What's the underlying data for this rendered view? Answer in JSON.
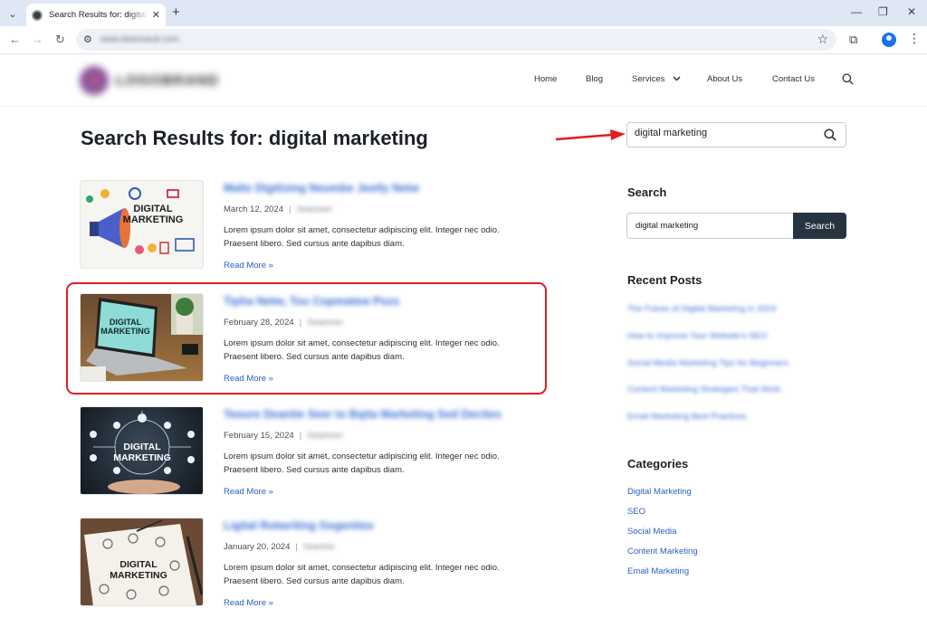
{
  "browser": {
    "tab_title": "Search Results for: digital marketing",
    "url": "www.downsaub.com"
  },
  "site": {
    "logo_text": "LOGOBRAND",
    "nav": [
      "Home",
      "Blog",
      "Services",
      "About Us",
      "Contact Us"
    ]
  },
  "page": {
    "title": "Search Results for: digital marketing",
    "search_value": "digital marketing"
  },
  "results": [
    {
      "title": "Maltz Digitizing Neumbe Jeetly Netw",
      "date": "March 12, 2024",
      "author": "Searlown",
      "excerpt": "Lorem ipsum dolor sit amet, consectetur adipiscing elit. Integer nec odio. Praesent libero. Sed cursus ante dapibus diam.",
      "read_more": "Read More »",
      "thumb_caption": "DIGITAL MARKETING"
    },
    {
      "title": "Tipha Netw, Tou Copmatew Pozs",
      "date": "February 28, 2024",
      "author": "Searlown",
      "excerpt": "Lorem ipsum dolor sit amet, consectetur adipiscing elit. Integer nec odio. Praesent libero. Sed cursus ante dapibus diam.",
      "read_more": "Read More »",
      "thumb_caption": "DIGITAL MARKETING"
    },
    {
      "title": "Teoure Deantie Seer to Bqita Marketing Sed Decites",
      "date": "February 15, 2024",
      "author": "Searlown",
      "excerpt": "Lorem ipsum dolor sit amet, consectetur adipiscing elit. Integer nec odio. Praesent libero. Sed cursus ante dapibus diam.",
      "read_more": "Read More »",
      "thumb_caption": "DIGITAL MARKETING"
    },
    {
      "title": "Ligital Rotwriting Gegenties",
      "date": "January 20, 2024",
      "author": "Searlow",
      "excerpt": "Lorem ipsum dolor sit amet, consectetur adipiscing elit. Integer nec odio. Praesent libero. Sed cursus ante dapibus diam.",
      "read_more": "Read More »",
      "thumb_caption": "DIGITAL MARKETING"
    }
  ],
  "sidebar": {
    "search_heading": "Search",
    "search_value": "digital marketing",
    "search_button": "Search",
    "recent_heading": "Recent Posts",
    "recent_posts": [
      "The Future of Digital Marketing in 2024",
      "How to Improve Your Website's SEO",
      "Social Media Marketing Tips for Beginners",
      "Content Marketing Strategies That Work",
      "Email Marketing Best Practices"
    ],
    "categories_heading": "Categories",
    "categories": [
      "Digital Marketing",
      "SEO",
      "Social Media",
      "Content Marketing",
      "Email Marketing"
    ]
  },
  "colors": {
    "accent_link": "#2a5fc4",
    "search_button": "#263340",
    "highlight": "#e01e24"
  }
}
